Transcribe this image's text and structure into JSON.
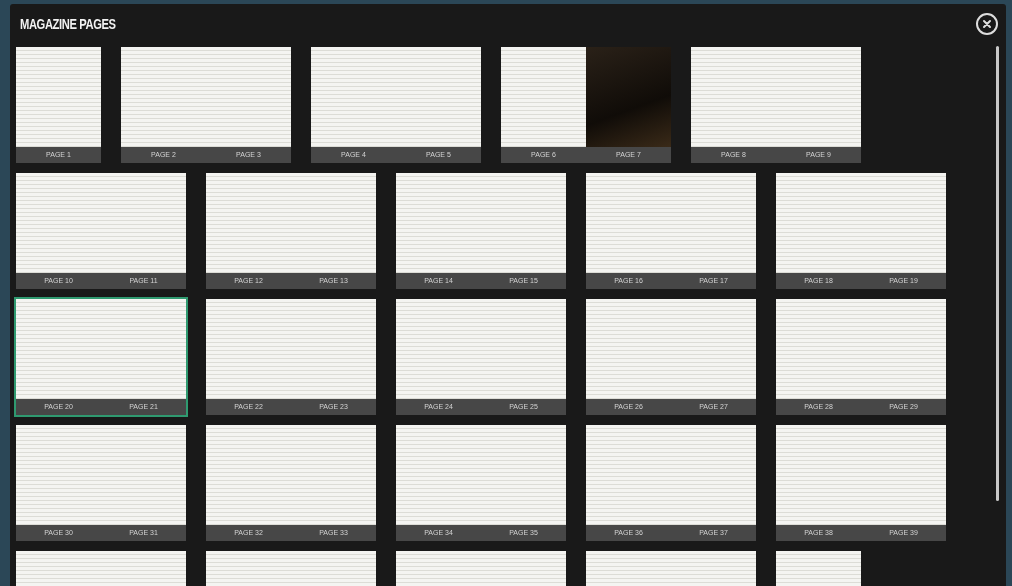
{
  "window": {
    "title": "MAGAZINE PAGES"
  },
  "spreads": [
    {
      "selected": false,
      "pages": [
        {
          "label": "PAGE 1",
          "kind": "page"
        }
      ]
    },
    {
      "selected": false,
      "pages": [
        {
          "label": "PAGE 2",
          "kind": "page"
        },
        {
          "label": "PAGE 3",
          "kind": "page"
        }
      ]
    },
    {
      "selected": false,
      "pages": [
        {
          "label": "PAGE 4",
          "kind": "page"
        },
        {
          "label": "PAGE 5",
          "kind": "page"
        }
      ]
    },
    {
      "selected": false,
      "pages": [
        {
          "label": "PAGE 6",
          "kind": "page"
        },
        {
          "label": "PAGE 7",
          "kind": "photo"
        }
      ]
    },
    {
      "selected": false,
      "pages": [
        {
          "label": "PAGE 8",
          "kind": "page"
        },
        {
          "label": "PAGE 9",
          "kind": "page"
        }
      ]
    },
    {
      "selected": false,
      "pages": [
        {
          "label": "PAGE 10",
          "kind": "page"
        },
        {
          "label": "PAGE 11",
          "kind": "page"
        }
      ]
    },
    {
      "selected": false,
      "pages": [
        {
          "label": "PAGE 12",
          "kind": "page"
        },
        {
          "label": "PAGE 13",
          "kind": "page"
        }
      ]
    },
    {
      "selected": false,
      "pages": [
        {
          "label": "PAGE 14",
          "kind": "page"
        },
        {
          "label": "PAGE 15",
          "kind": "page"
        }
      ]
    },
    {
      "selected": false,
      "pages": [
        {
          "label": "PAGE 16",
          "kind": "page"
        },
        {
          "label": "PAGE 17",
          "kind": "page"
        }
      ]
    },
    {
      "selected": false,
      "pages": [
        {
          "label": "PAGE 18",
          "kind": "page"
        },
        {
          "label": "PAGE 19",
          "kind": "page"
        }
      ]
    },
    {
      "selected": true,
      "pages": [
        {
          "label": "PAGE 20",
          "kind": "page"
        },
        {
          "label": "PAGE 21",
          "kind": "page"
        }
      ]
    },
    {
      "selected": false,
      "pages": [
        {
          "label": "PAGE 22",
          "kind": "page"
        },
        {
          "label": "PAGE 23",
          "kind": "page"
        }
      ]
    },
    {
      "selected": false,
      "pages": [
        {
          "label": "PAGE 24",
          "kind": "page"
        },
        {
          "label": "PAGE 25",
          "kind": "page"
        }
      ]
    },
    {
      "selected": false,
      "pages": [
        {
          "label": "PAGE 26",
          "kind": "page"
        },
        {
          "label": "PAGE 27",
          "kind": "page"
        }
      ]
    },
    {
      "selected": false,
      "pages": [
        {
          "label": "PAGE 28",
          "kind": "page"
        },
        {
          "label": "PAGE 29",
          "kind": "page"
        }
      ]
    },
    {
      "selected": false,
      "pages": [
        {
          "label": "PAGE 30",
          "kind": "page"
        },
        {
          "label": "PAGE 31",
          "kind": "page"
        }
      ]
    },
    {
      "selected": false,
      "pages": [
        {
          "label": "PAGE 32",
          "kind": "page"
        },
        {
          "label": "PAGE 33",
          "kind": "page"
        }
      ]
    },
    {
      "selected": false,
      "pages": [
        {
          "label": "PAGE 34",
          "kind": "page"
        },
        {
          "label": "PAGE 35",
          "kind": "page"
        }
      ]
    },
    {
      "selected": false,
      "pages": [
        {
          "label": "PAGE 36",
          "kind": "page"
        },
        {
          "label": "PAGE 37",
          "kind": "page"
        }
      ]
    },
    {
      "selected": false,
      "pages": [
        {
          "label": "PAGE 38",
          "kind": "page"
        },
        {
          "label": "PAGE 39",
          "kind": "page"
        }
      ]
    },
    {
      "selected": false,
      "pages": [
        {
          "kind": "page"
        },
        {
          "kind": "page"
        }
      ]
    },
    {
      "selected": false,
      "pages": [
        {
          "kind": "page"
        },
        {
          "kind": "page"
        }
      ]
    },
    {
      "selected": false,
      "pages": [
        {
          "kind": "page"
        },
        {
          "kind": "page"
        }
      ]
    },
    {
      "selected": false,
      "pages": [
        {
          "kind": "page"
        },
        {
          "kind": "page"
        }
      ]
    },
    {
      "selected": false,
      "pages": [
        {
          "kind": "page"
        }
      ]
    }
  ]
}
